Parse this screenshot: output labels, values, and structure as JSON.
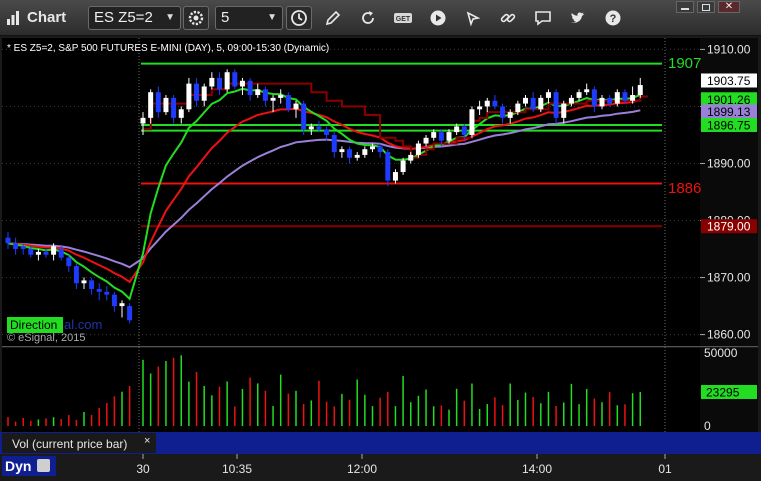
{
  "window": {
    "title": "Chart",
    "symbol": "ES Z5=2",
    "interval": "5"
  },
  "chart": {
    "header": "* ES Z5=2, S&P 500 FUTURES E-MINI (DAY), 5, 09:00-15:30 (Dynamic)",
    "watermark_direction": "Direction",
    "watermark_site": "al.com",
    "copyright": "© eSignal, 2015",
    "price_ticks": [
      "1910.00",
      "1900.00",
      "1890.00",
      "1880.00",
      "1870.00",
      "1860.00"
    ],
    "price_badges": {
      "last": "1903.75",
      "green1": "1901.26",
      "purple": "1899.13",
      "green2": "1896.75",
      "red": "1879.00"
    },
    "line_labels": {
      "green_top": "1907",
      "red_mid": "1886"
    },
    "volume_ticks": [
      "50000",
      "0"
    ],
    "volume_badge": "23295",
    "time_labels": [
      "30",
      "10:35",
      "12:00",
      "14:00",
      "01"
    ],
    "study_label": "Vol (current price bar)",
    "study_close": "×",
    "bottom_tab": "Dyn"
  },
  "colors": {
    "up": "#ffffff",
    "down": "#1e3cff",
    "green_line": "#22dd22",
    "red_line": "#ee1111",
    "purple_line": "#9a80d8",
    "dark_red_line": "#8a0000"
  },
  "chart_data": {
    "type": "candlestick",
    "price_range": [
      1858,
      1912
    ],
    "volume_range": [
      0,
      50000
    ],
    "last_price": 1903.75,
    "last_volume": 23295,
    "levels": {
      "green_top": 1907.5,
      "green_a": 1896.75,
      "green_b": 1895.75,
      "red_mid": 1886.5,
      "dark_red": 1879.0
    },
    "candles": [
      [
        1877,
        1878,
        1875,
        1876
      ],
      [
        1876,
        1877,
        1874,
        1875
      ],
      [
        1875.5,
        1876,
        1874,
        1875
      ],
      [
        1875,
        1875.5,
        1873.5,
        1874
      ],
      [
        1874,
        1875,
        1873,
        1874.5
      ],
      [
        1874.5,
        1875,
        1873.5,
        1874
      ],
      [
        1874,
        1876,
        1873,
        1875.5
      ],
      [
        1875,
        1875.5,
        1873,
        1873.5
      ],
      [
        1873.5,
        1874,
        1871,
        1872
      ],
      [
        1872,
        1872.5,
        1868,
        1869
      ],
      [
        1869,
        1870,
        1868,
        1869.5
      ],
      [
        1869.5,
        1870,
        1867,
        1868
      ],
      [
        1868,
        1869,
        1866,
        1867.5
      ],
      [
        1867.5,
        1868.5,
        1866,
        1867
      ],
      [
        1867,
        1867.5,
        1864,
        1865
      ],
      [
        1865,
        1866,
        1863,
        1865.5
      ],
      [
        1865,
        1865.5,
        1862,
        1862.5
      ],
      [
        1897,
        1899,
        1895,
        1898
      ],
      [
        1898,
        1903,
        1897,
        1902.5
      ],
      [
        1902.5,
        1903.5,
        1898,
        1899
      ],
      [
        1899,
        1902,
        1898.5,
        1901.5
      ],
      [
        1901.5,
        1902,
        1897,
        1898
      ],
      [
        1898,
        1900,
        1897,
        1899.5
      ],
      [
        1899.5,
        1905,
        1899,
        1904
      ],
      [
        1904,
        1905,
        1900,
        1901
      ],
      [
        1901,
        1904,
        1900,
        1903.5
      ],
      [
        1903.5,
        1906,
        1903,
        1905
      ],
      [
        1905,
        1906,
        1902,
        1903
      ],
      [
        1903,
        1906.5,
        1902.5,
        1906
      ],
      [
        1906,
        1906.5,
        1903,
        1903.5
      ],
      [
        1903.5,
        1905,
        1902,
        1904.5
      ],
      [
        1904.5,
        1905,
        1901,
        1902
      ],
      [
        1902,
        1904,
        1901.5,
        1903
      ],
      [
        1903,
        1903.5,
        1900,
        1901
      ],
      [
        1901,
        1902,
        1899,
        1901.5
      ],
      [
        1901.5,
        1903,
        1900.5,
        1902
      ],
      [
        1902,
        1902.5,
        1899,
        1899.5
      ],
      [
        1899.5,
        1901,
        1898,
        1900.5
      ],
      [
        1900.5,
        1901,
        1895,
        1896
      ],
      [
        1896,
        1897,
        1895,
        1896.5
      ],
      [
        1896.5,
        1897.5,
        1895.5,
        1896
      ],
      [
        1896,
        1896.5,
        1894,
        1895
      ],
      [
        1895,
        1895.5,
        1891,
        1892
      ],
      [
        1892,
        1893,
        1891,
        1892.5
      ],
      [
        1892.5,
        1893,
        1890,
        1891
      ],
      [
        1891,
        1892,
        1890.5,
        1891.5
      ],
      [
        1891.5,
        1893,
        1891,
        1892.5
      ],
      [
        1892.5,
        1893.5,
        1892,
        1893
      ],
      [
        1893,
        1893.5,
        1891,
        1892
      ],
      [
        1892,
        1892.5,
        1886,
        1887
      ],
      [
        1887,
        1889,
        1886.5,
        1888.5
      ],
      [
        1888.5,
        1891,
        1888,
        1890.5
      ],
      [
        1890.5,
        1892,
        1890,
        1891.5
      ],
      [
        1891.5,
        1894,
        1891,
        1893.5
      ],
      [
        1893.5,
        1895,
        1893,
        1894.5
      ],
      [
        1894.5,
        1896,
        1894,
        1895.5
      ],
      [
        1895.5,
        1896,
        1893,
        1894
      ],
      [
        1894,
        1896,
        1893.5,
        1895.5
      ],
      [
        1895.5,
        1897,
        1895,
        1896.5
      ],
      [
        1896.5,
        1897,
        1894,
        1895
      ],
      [
        1895,
        1900,
        1894.5,
        1899.5
      ],
      [
        1899.5,
        1901,
        1898.5,
        1900
      ],
      [
        1900,
        1901.5,
        1899,
        1901
      ],
      [
        1901,
        1902,
        1899.5,
        1900
      ],
      [
        1900,
        1900.5,
        1897,
        1898
      ],
      [
        1898,
        1899.5,
        1897,
        1899
      ],
      [
        1899,
        1901,
        1898.5,
        1900.5
      ],
      [
        1900.5,
        1902,
        1900,
        1901.5
      ],
      [
        1901.5,
        1902.5,
        1899,
        1899.5
      ],
      [
        1899.5,
        1902,
        1899,
        1901.5
      ],
      [
        1901.5,
        1903,
        1900.5,
        1902.5
      ],
      [
        1902.5,
        1903,
        1897,
        1898
      ],
      [
        1898,
        1901,
        1897,
        1900.5
      ],
      [
        1900.5,
        1902,
        1900,
        1901.5
      ],
      [
        1901.5,
        1903,
        1901,
        1902.5
      ],
      [
        1902.5,
        1904,
        1902,
        1903
      ],
      [
        1903,
        1903.5,
        1899,
        1900
      ],
      [
        1900,
        1902,
        1899.5,
        1901.5
      ],
      [
        1901.5,
        1902,
        1900,
        1900.5
      ],
      [
        1900.5,
        1903,
        1900,
        1902.5
      ],
      [
        1902.5,
        1903,
        1900.5,
        1901
      ],
      [
        1901,
        1903.5,
        1900.5,
        1902
      ],
      [
        1902,
        1905,
        1901.5,
        1903.75
      ]
    ],
    "volumes": [
      6200,
      3000,
      5500,
      3500,
      4500,
      5200,
      6000,
      4800,
      7500,
      4200,
      9600,
      7600,
      12400,
      15800,
      20300,
      23500,
      27400,
      45300,
      36000,
      40700,
      44500,
      46700,
      48400,
      30400,
      37000,
      27400,
      21000,
      26900,
      30500,
      13300,
      25400,
      33200,
      29200,
      24100,
      13700,
      35200,
      22200,
      24100,
      15100,
      17500,
      31000,
      16600,
      13400,
      22000,
      18000,
      31800,
      21400,
      13600,
      19400,
      23400,
      13600,
      34200,
      16300,
      20700,
      25000,
      13500,
      14100,
      11200,
      25500,
      17300,
      29100,
      11700,
      15000,
      19600,
      14300,
      29100,
      17900,
      22900,
      19800,
      15600,
      23400,
      13700,
      16100,
      28900,
      14900,
      25400,
      18800,
      16300,
      23200,
      14200,
      14800,
      22500,
      23295
    ]
  }
}
